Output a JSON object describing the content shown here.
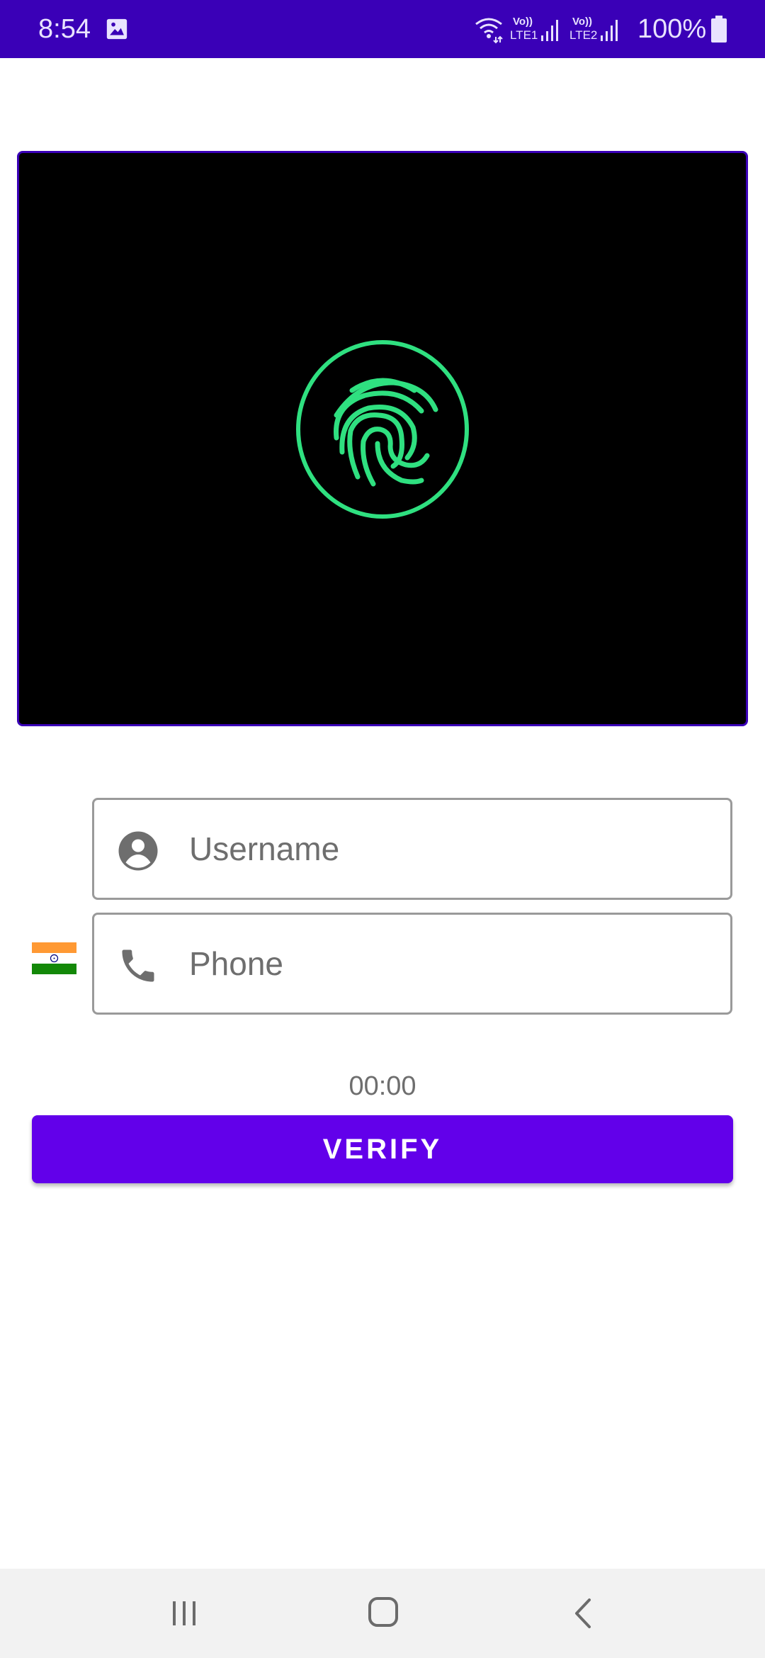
{
  "status_bar": {
    "time": "8:54",
    "sim1_top": "Vo))",
    "sim1_bottom": "LTE1",
    "sim2_top": "Vo))",
    "sim2_bottom": "LTE2",
    "battery": "100%",
    "icons": [
      "gallery-icon",
      "wifi-icon",
      "signal-icon",
      "signal-icon",
      "battery-icon"
    ]
  },
  "preview": {
    "icon": "fingerprint-icon",
    "accent_color": "#2fe080"
  },
  "form": {
    "username_placeholder": "Username",
    "phone_placeholder": "Phone",
    "username_icon": "account-circle-icon",
    "phone_icon": "phone-icon",
    "country_flag": "india-flag"
  },
  "timer": "00:00",
  "verify_label": "VERIFY",
  "colors": {
    "status_bar": "#3a00b7",
    "button": "#6200ea",
    "placeholder_text": "#6e6e6e"
  },
  "nav_bar": {
    "icons": [
      "recents-icon",
      "home-icon",
      "back-icon"
    ]
  }
}
